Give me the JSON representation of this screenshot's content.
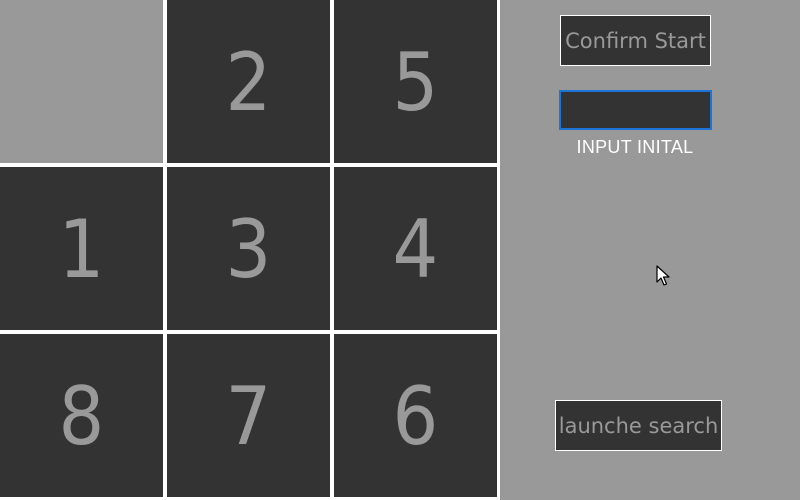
{
  "board": {
    "tiles": [
      {
        "label": "",
        "empty": true
      },
      {
        "label": "2"
      },
      {
        "label": "5"
      },
      {
        "label": "1"
      },
      {
        "label": "3"
      },
      {
        "label": "4"
      },
      {
        "label": "8"
      },
      {
        "label": "7"
      },
      {
        "label": "6"
      }
    ]
  },
  "controls": {
    "confirm_label": "Confirm Start",
    "input_value": "",
    "input_label": "INPUT INITAL",
    "search_label": "launche search"
  },
  "colors": {
    "tile": "#333333",
    "tile_text": "#999999",
    "background": "#999999",
    "grid_lines": "#ffffff",
    "input_focus": "#1e73d8"
  },
  "icons": {
    "pointer": "mouse-pointer-icon"
  }
}
